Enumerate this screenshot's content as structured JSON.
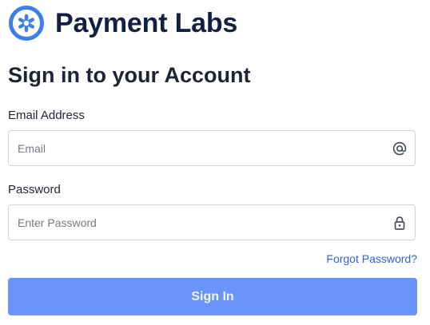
{
  "brand": {
    "name": "Payment Labs",
    "logo_icon": "payment-labs-logo",
    "logo_color": "#3d7ee8",
    "name_color": "#13203f"
  },
  "form": {
    "title": "Sign in to your Account",
    "email": {
      "label": "Email Address",
      "placeholder": "Email",
      "value": "",
      "icon": "at-sign-icon"
    },
    "password": {
      "label": "Password",
      "placeholder": "Enter Password",
      "value": "",
      "icon": "lock-icon"
    },
    "forgot_link": "Forgot Password?",
    "submit_label": "Sign In"
  },
  "colors": {
    "link": "#2f62d8",
    "button_bg": "#6894fb",
    "button_text": "#eef3ff",
    "input_border": "#cfd3d9"
  }
}
